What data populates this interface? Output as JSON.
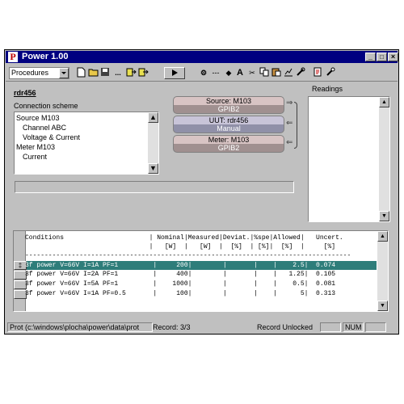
{
  "window": {
    "title": "Power 1.00",
    "app_icon_letter": "P"
  },
  "title_buttons": {
    "minimize": "_",
    "maximize": "□",
    "close": "×"
  },
  "toolbar": {
    "combo_value": "Procedures"
  },
  "uut": {
    "name": "rdr456"
  },
  "connection": {
    "label": "Connection scheme",
    "tree": [
      "Source M103",
      "Channel ABC",
      "Voltage & Current",
      "Meter M103",
      "Current"
    ]
  },
  "devices": {
    "source": {
      "line1": "Source: M103",
      "line2": "GPIB2"
    },
    "uut": {
      "line1": "UUT: rdr456",
      "line2": "Manual"
    },
    "meter": {
      "line1": "Meter: M103",
      "line2": "GPIB2"
    }
  },
  "readings": {
    "label": "Readings"
  },
  "table": {
    "header1": "Conditions                      | Nominal|Measured|Deviat.|%spe|Allowed|   Uncert.",
    "header2": "                                |   [W]  |   [W]  |  [%]  | [%]|  [%]  |     [%]",
    "separator": "------------------------------------------------------------------------------------",
    "rows": [
      "3f power V=66V I=1A PF=1         |     200|        |       |    |    2.5|  0.074",
      "3f power V=66V I=2A PF=1         |     400|        |       |    |   1.25|  0.105",
      "3f power V=66V I=5A PF=1         |    1000|        |       |    |    0.5|  0.081",
      "3f power V=66V I=1A PF=0.5       |     100|        |       |    |      5|  0.313"
    ],
    "selected_marker": "‡"
  },
  "statusbar": {
    "path": "Prot (c:\\windows\\plocha\\power\\data\\prot",
    "record": "Record: 3/3",
    "lock": "Record Unlocked",
    "num": "NUM"
  },
  "colors": {
    "titlebar": "#000080",
    "selected_row": "#2e7d7a",
    "face": "#c0c0c0"
  }
}
